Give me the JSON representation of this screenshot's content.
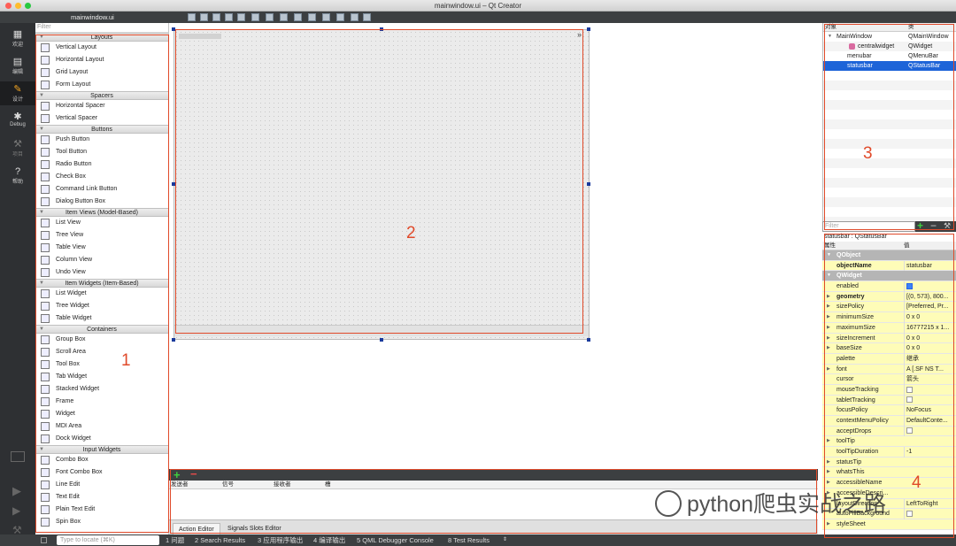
{
  "window": {
    "title": "mainwindow.ui – Qt Creator",
    "file_name": "mainwindow.ui"
  },
  "modes": [
    {
      "label": "欢迎",
      "icon": "grid-icon"
    },
    {
      "label": "编辑",
      "icon": "edit-icon"
    },
    {
      "label": "设计",
      "icon": "pencil-icon"
    },
    {
      "label": "Debug",
      "icon": "bug-icon"
    },
    {
      "label": "项目",
      "icon": "wrench-icon"
    },
    {
      "label": "帮助",
      "icon": "help-icon"
    }
  ],
  "widget_box": {
    "filter_placeholder": "Filter",
    "categories": [
      {
        "name": "Layouts",
        "items": [
          "Vertical Layout",
          "Horizontal Layout",
          "Grid Layout",
          "Form Layout"
        ]
      },
      {
        "name": "Spacers",
        "items": [
          "Horizontal Spacer",
          "Vertical Spacer"
        ]
      },
      {
        "name": "Buttons",
        "items": [
          "Push Button",
          "Tool Button",
          "Radio Button",
          "Check Box",
          "Command Link Button",
          "Dialog Button Box"
        ]
      },
      {
        "name": "Item Views (Model-Based)",
        "items": [
          "List View",
          "Tree View",
          "Table View",
          "Column View",
          "Undo View"
        ]
      },
      {
        "name": "Item Widgets (Item-Based)",
        "items": [
          "List Widget",
          "Tree Widget",
          "Table Widget"
        ]
      },
      {
        "name": "Containers",
        "items": [
          "Group Box",
          "Scroll Area",
          "Tool Box",
          "Tab Widget",
          "Stacked Widget",
          "Frame",
          "Widget",
          "MDI Area",
          "Dock Widget"
        ]
      },
      {
        "name": "Input Widgets",
        "items": [
          "Combo Box",
          "Font Combo Box",
          "Line Edit",
          "Text Edit",
          "Plain Text Edit",
          "Spin Box"
        ]
      }
    ]
  },
  "action_editor": {
    "columns": [
      "发送者",
      "信号",
      "接收者",
      "槽"
    ],
    "tabs": [
      "Action Editor",
      "Signals  Slots Editor"
    ]
  },
  "object_inspector": {
    "columns": [
      "对象",
      "类"
    ],
    "rows": [
      {
        "object": "MainWindow",
        "class": "QMainWindow",
        "selected": false
      },
      {
        "object": "centralwidget",
        "class": "QWidget",
        "selected": false
      },
      {
        "object": "menubar",
        "class": "QMenuBar",
        "selected": false
      },
      {
        "object": "statusbar",
        "class": "QStatusBar",
        "selected": true
      }
    ]
  },
  "property_editor": {
    "filter_placeholder": "Filter",
    "class_label": "statusbar : QStatusBar",
    "columns": [
      "属性",
      "值"
    ],
    "rows": [
      {
        "name": "QObject",
        "value": "",
        "type": "group"
      },
      {
        "name": "objectName",
        "value": "statusbar",
        "type": "bold"
      },
      {
        "name": "QWidget",
        "value": "",
        "type": "group"
      },
      {
        "name": "enabled",
        "value": "",
        "type": "check-on"
      },
      {
        "name": "geometry",
        "value": "[(0, 573), 800...",
        "type": "bold-exp"
      },
      {
        "name": "sizePolicy",
        "value": "[Preferred, Pr...",
        "type": "exp"
      },
      {
        "name": "minimumSize",
        "value": "0 x 0",
        "type": "exp"
      },
      {
        "name": "maximumSize",
        "value": "16777215 x 1...",
        "type": "exp"
      },
      {
        "name": "sizeIncrement",
        "value": "0 x 0",
        "type": "exp"
      },
      {
        "name": "baseSize",
        "value": "0 x 0",
        "type": "exp"
      },
      {
        "name": "palette",
        "value": "继承",
        "type": "plain"
      },
      {
        "name": "font",
        "value": "A  [.SF NS T...",
        "type": "exp"
      },
      {
        "name": "cursor",
        "value": "箭头",
        "type": "plain"
      },
      {
        "name": "mouseTracking",
        "value": "",
        "type": "check-off"
      },
      {
        "name": "tabletTracking",
        "value": "",
        "type": "check-off"
      },
      {
        "name": "focusPolicy",
        "value": "NoFocus",
        "type": "plain"
      },
      {
        "name": "contextMenuPolicy",
        "value": "DefaultConte...",
        "type": "plain"
      },
      {
        "name": "acceptDrops",
        "value": "",
        "type": "check-off"
      },
      {
        "name": "toolTip",
        "value": "",
        "type": "exp"
      },
      {
        "name": "toolTipDuration",
        "value": "-1",
        "type": "plain"
      },
      {
        "name": "statusTip",
        "value": "",
        "type": "exp"
      },
      {
        "name": "whatsThis",
        "value": "",
        "type": "exp"
      },
      {
        "name": "accessibleName",
        "value": "",
        "type": "exp"
      },
      {
        "name": "accessibleDescri...",
        "value": "",
        "type": "exp"
      },
      {
        "name": "layoutDirection",
        "value": "LeftToRight",
        "type": "plain"
      },
      {
        "name": "autoFillBackground",
        "value": "",
        "type": "check-off"
      },
      {
        "name": "styleSheet",
        "value": "",
        "type": "exp"
      }
    ]
  },
  "bottom_bar": {
    "locate_placeholder": "Type to locate (⌘K)",
    "tabs": [
      "1 问题",
      "2 Search Results",
      "3 应用程序输出",
      "4 编译输出",
      "5 QML Debugger Console",
      "8 Test Results"
    ]
  },
  "annotations": {
    "labels": [
      "1",
      "2",
      "3",
      "4"
    ],
    "color": "#e04a2a"
  },
  "watermark": {
    "text": "python爬虫实战之路"
  }
}
